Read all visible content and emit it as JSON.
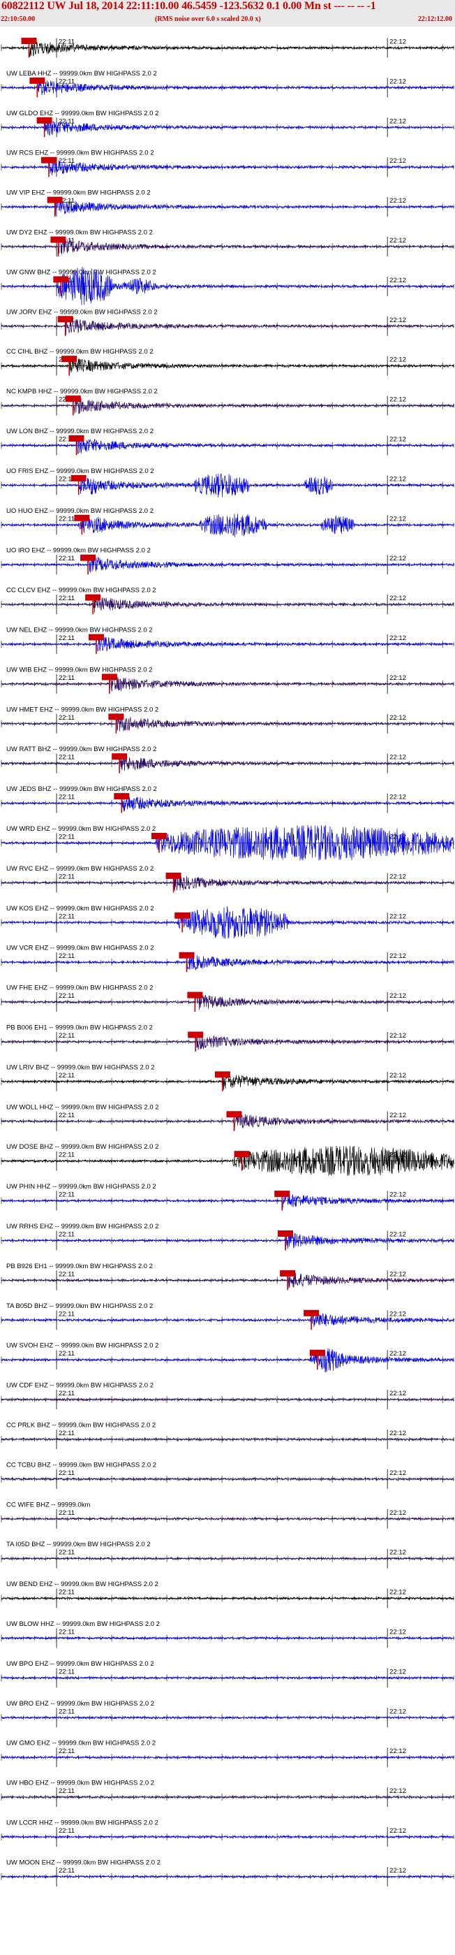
{
  "header": {
    "title": "60822112 UW Jul 18, 2014 22:11:10.00   46.5459 -123.5632  0.1 0.00 Mn st --- --  --   -1",
    "start_time": "22:10:50.00",
    "end_time": "22:12:12.00",
    "subtitle": "(RMS noise over 6.0 s scaled 20.0 x)"
  },
  "tick_labels": {
    "minute_1": "22:11",
    "minute_2": "22:12"
  },
  "colors": {
    "pick": "#cc0000",
    "trace_blue": "#0000ee",
    "trace_purple": "#2a0a66",
    "trace_black": "#000000",
    "header_bg": "#e9e9e9"
  },
  "chart_data": {
    "type": "line",
    "title": "60822112 UW Jul 18, 2014 22:11:10.00",
    "x_range": [
      "22:10:50.00",
      "22:12:12.00"
    ],
    "traces": [
      {
        "label": "",
        "color": "black",
        "pick_s": 5.0
      },
      {
        "label": "UW LEBA HHZ -- 99999.0km BW  HIGHPASS  2.0  2",
        "color": "blue",
        "pick_s": 6.5
      },
      {
        "label": "UW GLDO EHZ -- 99999.0km BW  HIGHPASS  2.0  2",
        "color": "blue",
        "pick_s": 7.8
      },
      {
        "label": "UW RCS EHZ -- 99999.0km BW  HIGHPASS  2.0  2",
        "color": "blue",
        "pick_s": 8.6
      },
      {
        "label": "UW VIP EHZ -- 99999.0km BW  HIGHPASS  2.0  2",
        "color": "blue",
        "pick_s": 9.7
      },
      {
        "label": "UW DY2 EHZ -- 99999.0km BW  HIGHPASS  2.0  2",
        "color": "purple",
        "pick_s": 10.3
      },
      {
        "label": "UW GNW BHZ -- 99999.0km BW  HIGHPASS  2.0  2",
        "color": "blue",
        "pick_s": 10.8
      },
      {
        "label": "UW JORV EHZ -- 99999.0km BW  HIGHPASS  2.0  2",
        "color": "purple",
        "pick_s": 11.6
      },
      {
        "label": "CC CIHL BHZ -- 99999.0km BW  HIGHPASS  2.0  2",
        "color": "black",
        "pick_s": 12.3
      },
      {
        "label": "NC KMPB HHZ -- 99999.0km BW  HIGHPASS  2.0  2",
        "color": "purple",
        "pick_s": 13.0
      },
      {
        "label": "UW LON BHZ -- 99999.0km BW  HIGHPASS  2.0  2",
        "color": "blue",
        "pick_s": 13.6
      },
      {
        "label": "UO FRIS EHZ -- 99999.0km BW  HIGHPASS  2.0  2",
        "color": "blue",
        "pick_s": 14.0
      },
      {
        "label": "UO HUO EHZ -- 99999.0km BW  HIGHPASS  2.0  2",
        "color": "blue",
        "pick_s": 14.6
      },
      {
        "label": "UO IRO EHZ -- 99999.0km BW  HIGHPASS  2.0  2",
        "color": "blue",
        "pick_s": 15.7
      },
      {
        "label": "CC CLCV EHZ -- 99999.0km BW  HIGHPASS  2.0  2",
        "color": "purple",
        "pick_s": 16.6
      },
      {
        "label": "UW NEL EHZ -- 99999.0km BW  HIGHPASS  2.0  2",
        "color": "blue",
        "pick_s": 17.2
      },
      {
        "label": "UW WIB EHZ -- 99999.0km BW  HIGHPASS  2.0  2",
        "color": "purple",
        "pick_s": 19.6
      },
      {
        "label": "UW HMET EHZ -- 99999.0km BW  HIGHPASS  2.0  2",
        "color": "purple",
        "pick_s": 20.8
      },
      {
        "label": "UW RATT BHZ -- 99999.0km BW  HIGHPASS  2.0  2",
        "color": "purple",
        "pick_s": 21.4
      },
      {
        "label": "UW JEDS BHZ -- 99999.0km BW  HIGHPASS  2.0  2",
        "color": "blue",
        "pick_s": 21.8
      },
      {
        "label": "UW WRD EHZ -- 99999.0km BW  HIGHPASS  2.0  2",
        "color": "blue",
        "pick_s": 28.6
      },
      {
        "label": "UW RVC EHZ -- 99999.0km BW  HIGHPASS  2.0  2",
        "color": "purple",
        "pick_s": 31.2
      },
      {
        "label": "UW KOS EHZ -- 99999.0km BW  HIGHPASS  2.0  2",
        "color": "blue",
        "pick_s": 32.8
      },
      {
        "label": "UW VCR EHZ -- 99999.0km BW  HIGHPASS  2.0  2",
        "color": "blue",
        "pick_s": 33.6
      },
      {
        "label": "UW FHE EHZ -- 99999.0km BW  HIGHPASS  2.0  2",
        "color": "purple",
        "pick_s": 35.1
      },
      {
        "label": "PB B006 EH1 -- 99999.0km BW  HIGHPASS  2.0  2",
        "color": "purple",
        "pick_s": 35.2
      },
      {
        "label": "UW LRIV BHZ -- 99999.0km BW  HIGHPASS  2.0  2",
        "color": "black",
        "pick_s": 40.1
      },
      {
        "label": "UW WOLL HHZ -- 99999.0km BW  HIGHPASS  2.0  2",
        "color": "purple",
        "pick_s": 42.2
      },
      {
        "label": "UW DOSE BHZ -- 99999.0km BW  HIGHPASS  2.0  2",
        "color": "black",
        "pick_s": 43.6
      },
      {
        "label": "UW PHIN HHZ -- 99999.0km BW  HIGHPASS  2.0  2",
        "color": "blue",
        "pick_s": 50.9
      },
      {
        "label": "UW RRHS EHZ -- 99999.0km BW  HIGHPASS  2.0  2",
        "color": "blue",
        "pick_s": 51.5
      },
      {
        "label": "PB B926 EH1 -- 99999.0km BW  HIGHPASS  2.0  2",
        "color": "purple",
        "pick_s": 51.9
      },
      {
        "label": "TA B05D BHZ -- 99999.0km BW  HIGHPASS  2.0  2",
        "color": "blue",
        "pick_s": 56.2
      },
      {
        "label": "UW SVOH EHZ -- 99999.0km BW  HIGHPASS  2.0  2",
        "color": "blue",
        "pick_s": 57.3
      },
      {
        "label": "UW CDF EHZ -- 99999.0km BW  HIGHPASS  2.0  2",
        "color": "purple",
        "pick_s": null
      },
      {
        "label": "CC PRLK BHZ -- 99999.0km BW  HIGHPASS  2.0  2",
        "color": "purple",
        "pick_s": null
      },
      {
        "label": "CC TCBU BHZ -- 99999.0km BW  HIGHPASS  2.0  2",
        "color": "purple",
        "pick_s": null
      },
      {
        "label": "CC WIFE BHZ -- 99999.0km",
        "color": "purple",
        "pick_s": null
      },
      {
        "label": "TA I05D BHZ -- 99999.0km BW  HIGHPASS  2.0  2",
        "color": "purple",
        "pick_s": null
      },
      {
        "label": "UW BEND EHZ -- 99999.0km BW  HIGHPASS  2.0  2",
        "color": "black",
        "pick_s": null
      },
      {
        "label": "UW BLOW HHZ -- 99999.0km BW  HIGHPASS  2.0  2",
        "color": "blue",
        "pick_s": null
      },
      {
        "label": "UW BPO EHZ -- 99999.0km BW  HIGHPASS  2.0  2",
        "color": "blue",
        "pick_s": null
      },
      {
        "label": "UW BRO EHZ -- 99999.0km BW  HIGHPASS  2.0  2",
        "color": "blue",
        "pick_s": null
      },
      {
        "label": "UW GMO EHZ -- 99999.0km BW  HIGHPASS  2.0  2",
        "color": "blue",
        "pick_s": null
      },
      {
        "label": "UW HBO EHZ -- 99999.0km BW  HIGHPASS  2.0  2",
        "color": "purple",
        "pick_s": null
      },
      {
        "label": "UW LCCR HHZ -- 99999.0km BW  HIGHPASS  2.0  2",
        "color": "blue",
        "pick_s": null
      },
      {
        "label": "UW MOON EHZ -- 99999.0km BW  HIGHPASS  2.0  2",
        "color": "blue",
        "pick_s": null
      }
    ]
  }
}
